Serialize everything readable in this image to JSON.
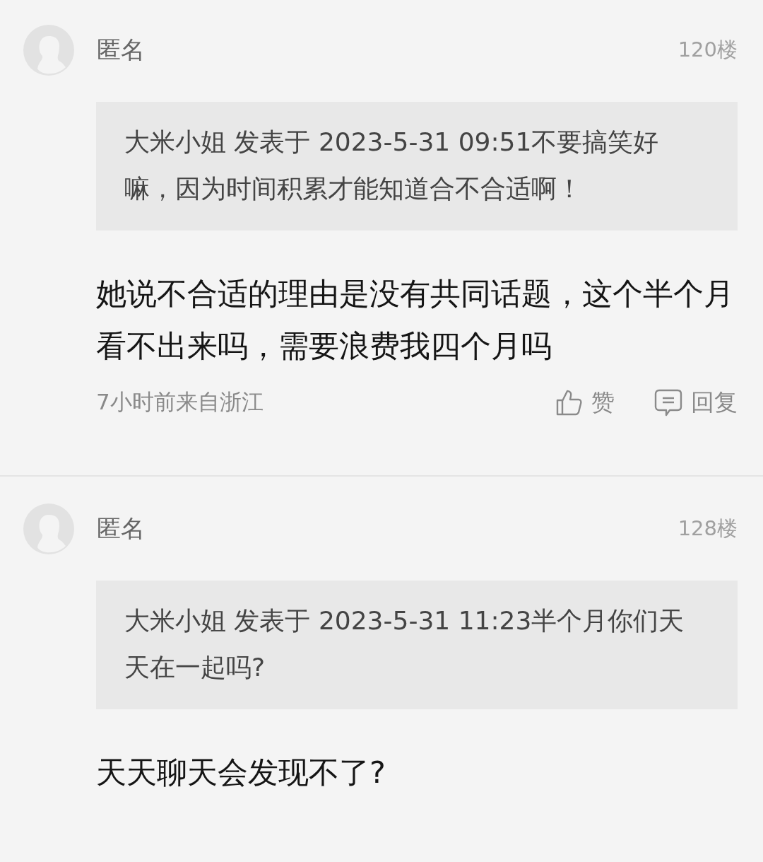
{
  "posts": [
    {
      "author": "匿名",
      "floor": "120楼",
      "quote": "大米小姐 发表于 2023-5-31 09:51不要搞笑好嘛，因为时间积累才能知道合不合适啊！",
      "content": "她说不合适的理由是没有共同话题，这个半个月看不出来吗，需要浪费我四个月吗",
      "meta": "7小时前来自浙江",
      "like_label": "赞",
      "reply_label": "回复"
    },
    {
      "author": "匿名",
      "floor": "128楼",
      "quote": "大米小姐 发表于 2023-5-31 11:23半个月你们天天在一起吗?",
      "content": "天天聊天会发现不了?"
    }
  ]
}
